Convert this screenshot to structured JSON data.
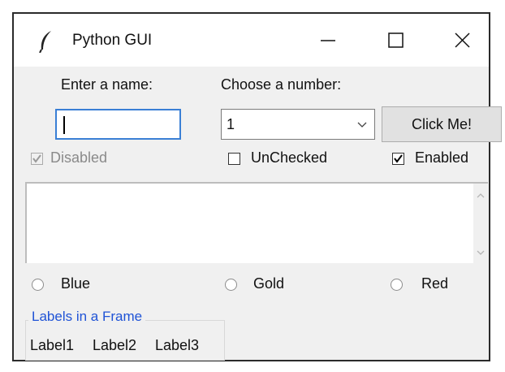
{
  "window": {
    "title": "Python GUI",
    "controls": {
      "minimize": "minimize-icon",
      "maximize": "maximize-icon",
      "close": "close-icon"
    }
  },
  "form": {
    "name_label": "Enter a name:",
    "name_value": "",
    "number_label": "Choose a number:",
    "number_value": "1",
    "button_label": "Click Me!"
  },
  "checkboxes": [
    {
      "label": "Disabled",
      "checked": true,
      "enabled": false
    },
    {
      "label": "UnChecked",
      "checked": false,
      "enabled": true
    },
    {
      "label": "Enabled",
      "checked": true,
      "enabled": true
    }
  ],
  "radios": [
    {
      "label": "Blue",
      "selected": false
    },
    {
      "label": "Gold",
      "selected": false
    },
    {
      "label": "Red",
      "selected": false
    }
  ],
  "frame": {
    "title": "Labels in a Frame",
    "labels": [
      "Label1",
      "Label2",
      "Label3"
    ]
  },
  "colors": {
    "frame_title": "#1f53d6",
    "disabled_text": "#8a8a8a",
    "focus_border": "#3a7fd5"
  }
}
